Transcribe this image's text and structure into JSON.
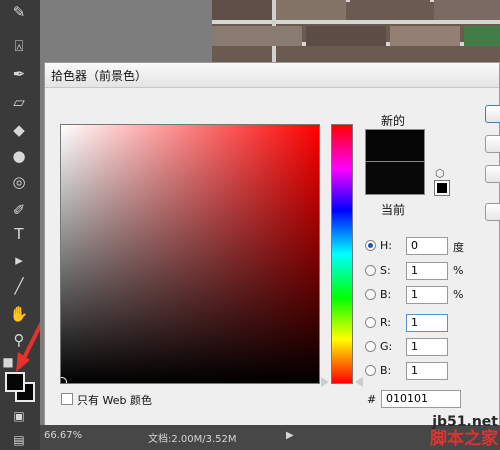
{
  "dialog": {
    "title": "拾色器（前景色）",
    "new_label": "新的",
    "current_label": "当前",
    "web_only_label": "只有 Web 颜色",
    "fields": {
      "H": {
        "label": "H:",
        "value": "0",
        "unit": "度"
      },
      "S": {
        "label": "S:",
        "value": "1",
        "unit": "%"
      },
      "B": {
        "label": "B:",
        "value": "1",
        "unit": "%"
      },
      "R": {
        "label": "R:",
        "value": "1"
      },
      "G": {
        "label": "G:",
        "value": "1"
      },
      "B2": {
        "label": "B:",
        "value": "1"
      }
    },
    "hex_symbol": "#",
    "hex_value": "010101"
  },
  "toolbar": {
    "tools": [
      "brush-icon",
      "stamp-icon",
      "history-brush-icon",
      "eraser-icon",
      "bucket-icon",
      "blur-icon",
      "sponge-icon",
      "pen-icon",
      "type-icon",
      "path-selection-icon",
      "line-icon",
      "hand-icon",
      "zoom-icon"
    ],
    "type_glyph": "T"
  },
  "status": {
    "zoom": "66.67%",
    "doc": "文档:2.00M/3.52M"
  },
  "watermark": {
    "site": "jb51.net",
    "name": "脚本之家"
  },
  "colors": {
    "foreground": "#050505",
    "accent": "#d33"
  }
}
